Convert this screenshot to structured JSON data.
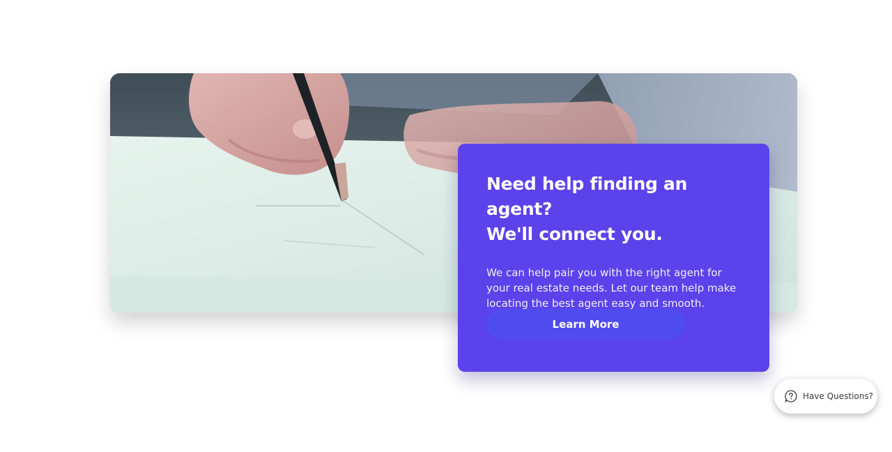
{
  "hero": {
    "image_alt": "Person signing a document with a pen"
  },
  "promo": {
    "title_line1": "Need help finding an agent?",
    "title_line2": "We'll connect you.",
    "body": "We can help pair you with the right agent for your real estate needs. Let our team help make locating the best agent easy and smooth.",
    "button_label": "Learn More",
    "background_color": "#5b42ea",
    "button_color": "#4f4cef"
  },
  "help_widget": {
    "label": "Have Questions?",
    "icon": "question-bubble-icon"
  }
}
